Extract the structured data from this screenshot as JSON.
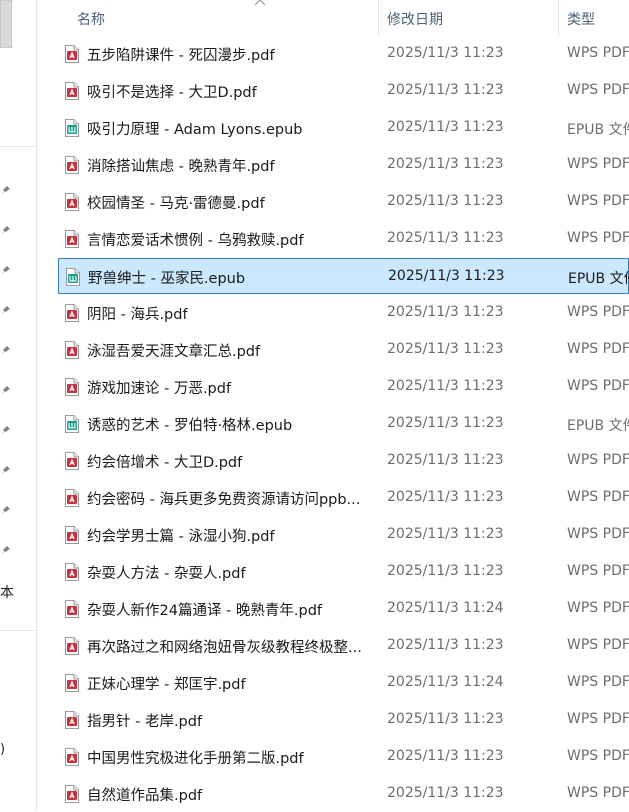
{
  "header": {
    "name": "名称",
    "date": "修改日期",
    "type": "类型"
  },
  "nav": {
    "label": "本",
    "paren": ")"
  },
  "icons": {
    "pdf": "wps-pdf-icon",
    "epub": "epub-book-icon",
    "pdf_color": "#c8313f",
    "epub_color": "#1b9e8e"
  },
  "selection": {
    "background": "#cce8ff",
    "border": "#3c7fb1"
  },
  "files": [
    {
      "name": "五步陷阱课件 - 死囚漫步.pdf",
      "date": "2025/11/3 11:23",
      "type": "WPS PDF",
      "kind": "pdf"
    },
    {
      "name": "吸引不是选择 - 大卫D.pdf",
      "date": "2025/11/3 11:23",
      "type": "WPS PDF",
      "kind": "pdf"
    },
    {
      "name": "吸引力原理 - Adam Lyons.epub",
      "date": "2025/11/3 11:23",
      "type": "EPUB 文件",
      "kind": "epub"
    },
    {
      "name": "消除搭讪焦虑 - 晚熟青年.pdf",
      "date": "2025/11/3 11:23",
      "type": "WPS PDF",
      "kind": "pdf"
    },
    {
      "name": "校园情圣 - 马克·雷德曼.pdf",
      "date": "2025/11/3 11:23",
      "type": "WPS PDF",
      "kind": "pdf"
    },
    {
      "name": "言情恋爱话术惯例 - 乌鸦救赎.pdf",
      "date": "2025/11/3 11:23",
      "type": "WPS PDF",
      "kind": "pdf"
    },
    {
      "name": "野兽绅士 - 巫家民.epub",
      "date": "2025/11/3 11:23",
      "type": "EPUB 文件",
      "kind": "epub",
      "selected": true
    },
    {
      "name": "阴阳 - 海兵.pdf",
      "date": "2025/11/3 11:23",
      "type": "WPS PDF",
      "kind": "pdf"
    },
    {
      "name": "泳湿吾爱天涯文章汇总.pdf",
      "date": "2025/11/3 11:23",
      "type": "WPS PDF",
      "kind": "pdf"
    },
    {
      "name": "游戏加速论 - 万恶.pdf",
      "date": "2025/11/3 11:23",
      "type": "WPS PDF",
      "kind": "pdf"
    },
    {
      "name": "诱惑的艺术 - 罗伯特·格林.epub",
      "date": "2025/11/3 11:23",
      "type": "EPUB 文件",
      "kind": "epub"
    },
    {
      "name": "约会倍增术 - 大卫D.pdf",
      "date": "2025/11/3 11:23",
      "type": "WPS PDF",
      "kind": "pdf"
    },
    {
      "name": "约会密码 - 海兵更多免费资源请访问ppb...",
      "date": "2025/11/3 11:23",
      "type": "WPS PDF",
      "kind": "pdf"
    },
    {
      "name": "约会学男士篇 - 泳湿小狗.pdf",
      "date": "2025/11/3 11:23",
      "type": "WPS PDF",
      "kind": "pdf"
    },
    {
      "name": "杂耍人方法 - 杂耍人.pdf",
      "date": "2025/11/3 11:23",
      "type": "WPS PDF",
      "kind": "pdf"
    },
    {
      "name": "杂耍人新作24篇通译 - 晚熟青年.pdf",
      "date": "2025/11/3 11:24",
      "type": "WPS PDF",
      "kind": "pdf"
    },
    {
      "name": "再次路过之和网络泡妞骨灰级教程终极整...",
      "date": "2025/11/3 11:23",
      "type": "WPS PDF",
      "kind": "pdf"
    },
    {
      "name": "正妹心理学 - 郑匡宇.pdf",
      "date": "2025/11/3 11:24",
      "type": "WPS PDF",
      "kind": "pdf"
    },
    {
      "name": "指男针 - 老岸.pdf",
      "date": "2025/11/3 11:23",
      "type": "WPS PDF",
      "kind": "pdf"
    },
    {
      "name": "中国男性究极进化手册第二版.pdf",
      "date": "2025/11/3 11:23",
      "type": "WPS PDF",
      "kind": "pdf"
    },
    {
      "name": "自然道作品集.pdf",
      "date": "2025/11/3 11:23",
      "type": "WPS PDF",
      "kind": "pdf"
    }
  ]
}
